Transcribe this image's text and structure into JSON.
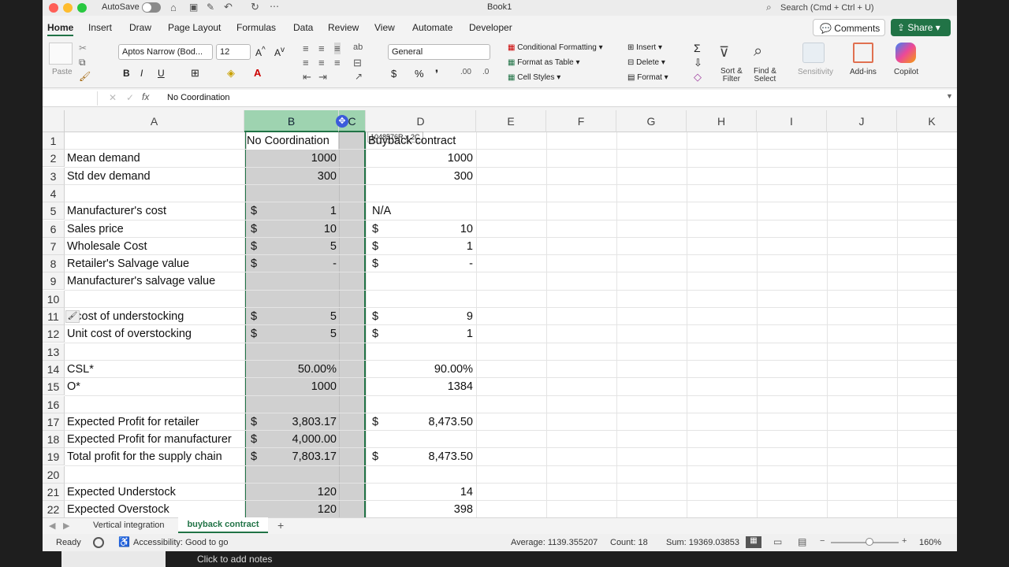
{
  "titlebar": {
    "autosave": "AutoSave",
    "doc_title": "Book1",
    "search_placeholder": "Search (Cmd + Ctrl + U)"
  },
  "tabs": [
    "Home",
    "Insert",
    "Draw",
    "Page Layout",
    "Formulas",
    "Data",
    "Review",
    "View",
    "Automate",
    "Developer"
  ],
  "header_buttons": {
    "comments": "Comments",
    "share": "Share"
  },
  "ribbon": {
    "paste": "Paste",
    "font_name": "Aptos Narrow (Bod...",
    "font_size": "12",
    "number_format": "General",
    "conditional_formatting": "Conditional Formatting",
    "format_as_table": "Format as Table",
    "cell_styles": "Cell Styles",
    "insert": "Insert",
    "delete": "Delete",
    "format": "Format",
    "sort_filter": "Sort &\nFilter",
    "find_select": "Find &\nSelect",
    "sensitivity": "Sensitivity",
    "add_ins": "Add-ins",
    "copilot": "Copilot"
  },
  "formula_bar": {
    "name_box": "",
    "content": "No Coordination"
  },
  "columns": [
    "A",
    "B",
    "C",
    "D",
    "E",
    "F",
    "G",
    "H",
    "I",
    "J",
    "K"
  ],
  "tooltip": "1048576R x 2C",
  "rows": [
    {
      "n": "1",
      "a": "",
      "b": "No Coordination",
      "bc": "",
      "d": "Buyback contract",
      "dc": ""
    },
    {
      "n": "2",
      "a": "Mean demand",
      "b": "",
      "bc": "1000",
      "d": "",
      "dc": "1000"
    },
    {
      "n": "3",
      "a": "Std dev demand",
      "b": "",
      "bc": "300",
      "d": "",
      "dc": "300"
    },
    {
      "n": "4",
      "a": "",
      "b": "",
      "bc": "",
      "d": "",
      "dc": ""
    },
    {
      "n": "5",
      "a": "Manufacturer's cost",
      "b": "$",
      "bc": "1",
      "d": "N/A",
      "dc": ""
    },
    {
      "n": "6",
      "a": "Sales price",
      "b": "$",
      "bc": "10",
      "d": "$",
      "dc": "10"
    },
    {
      "n": "7",
      "a": "Wholesale Cost",
      "b": "$",
      "bc": "5",
      "d": "$",
      "dc": "1"
    },
    {
      "n": "8",
      "a": "Retailer's Salvage value",
      "b": "$",
      "bc": "-",
      "d": "$",
      "dc": "-"
    },
    {
      "n": "9",
      "a": "Manufacturer's salvage value",
      "b": "",
      "bc": "",
      "d": "",
      "dc": ""
    },
    {
      "n": "10",
      "a": "",
      "b": "",
      "bc": "",
      "d": "",
      "dc": ""
    },
    {
      "n": "11",
      "a": "it cost of understocking",
      "b": "$",
      "bc": "5",
      "d": "$",
      "dc": "9"
    },
    {
      "n": "12",
      "a": "Unit cost of overstocking",
      "b": "$",
      "bc": "5",
      "d": "$",
      "dc": "1"
    },
    {
      "n": "13",
      "a": "",
      "b": "",
      "bc": "",
      "d": "",
      "dc": ""
    },
    {
      "n": "14",
      "a": "CSL*",
      "b": "",
      "bc": "50.00%",
      "d": "",
      "dc": "90.00%"
    },
    {
      "n": "15",
      "a": "O*",
      "b": "",
      "bc": "1000",
      "d": "",
      "dc": "1384"
    },
    {
      "n": "16",
      "a": "",
      "b": "",
      "bc": "",
      "d": "",
      "dc": ""
    },
    {
      "n": "17",
      "a": "Expected Profit for retailer",
      "b": "$",
      "bc": "3,803.17",
      "d": "$",
      "dc": "8,473.50"
    },
    {
      "n": "18",
      "a": "Expected Profit for manufacturer",
      "b": "$",
      "bc": "4,000.00",
      "d": "",
      "dc": ""
    },
    {
      "n": "19",
      "a": "Total profit for the supply chain",
      "b": "$",
      "bc": "7,803.17",
      "d": "$",
      "dc": "8,473.50"
    },
    {
      "n": "20",
      "a": "",
      "b": "",
      "bc": "",
      "d": "",
      "dc": ""
    },
    {
      "n": "21",
      "a": "Expected Understock",
      "b": "",
      "bc": "120",
      "d": "",
      "dc": "14"
    },
    {
      "n": "22",
      "a": "Expected Overstock",
      "b": "",
      "bc": "120",
      "d": "",
      "dc": "398"
    }
  ],
  "sheets": [
    "Vertical integration",
    "buyback contract"
  ],
  "status": {
    "ready": "Ready",
    "accessibility": "Accessibility: Good to go",
    "average": "Average: 1139.355207",
    "count": "Count: 18",
    "sum": "Sum: 19369.03853",
    "zoom": "160%"
  },
  "notes": "Click to add notes",
  "colors": {
    "excel_green": "#217346",
    "selection": "#d0d0d0",
    "header_sel": "#9ed3b0"
  }
}
